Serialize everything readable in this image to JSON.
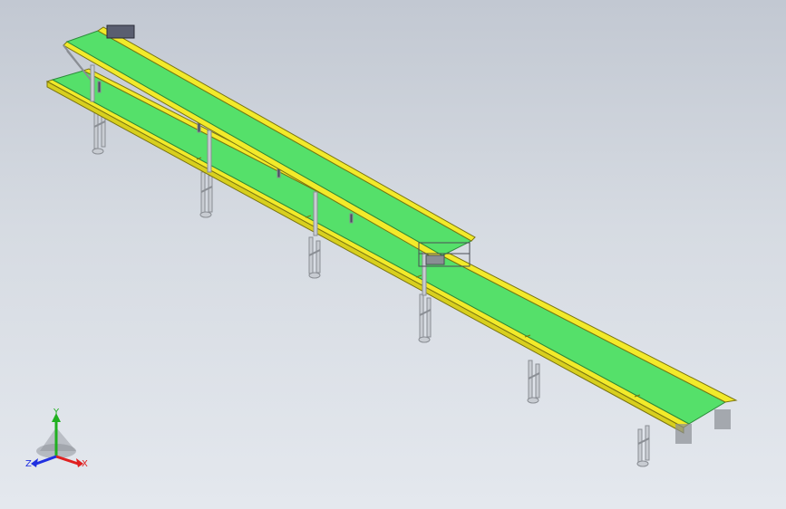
{
  "view": {
    "background_top": "#c2c8d2",
    "background_bottom": "#e4e8ee"
  },
  "model": {
    "belt_color": "#55e06a",
    "frame_color": "#f2ea2a",
    "leg_color": "#c8ccd2"
  },
  "triad": {
    "x_label": "X",
    "y_label": "Y",
    "z_label": "Z",
    "x_color": "#e02020",
    "y_color": "#20b020",
    "z_color": "#2030e0"
  }
}
